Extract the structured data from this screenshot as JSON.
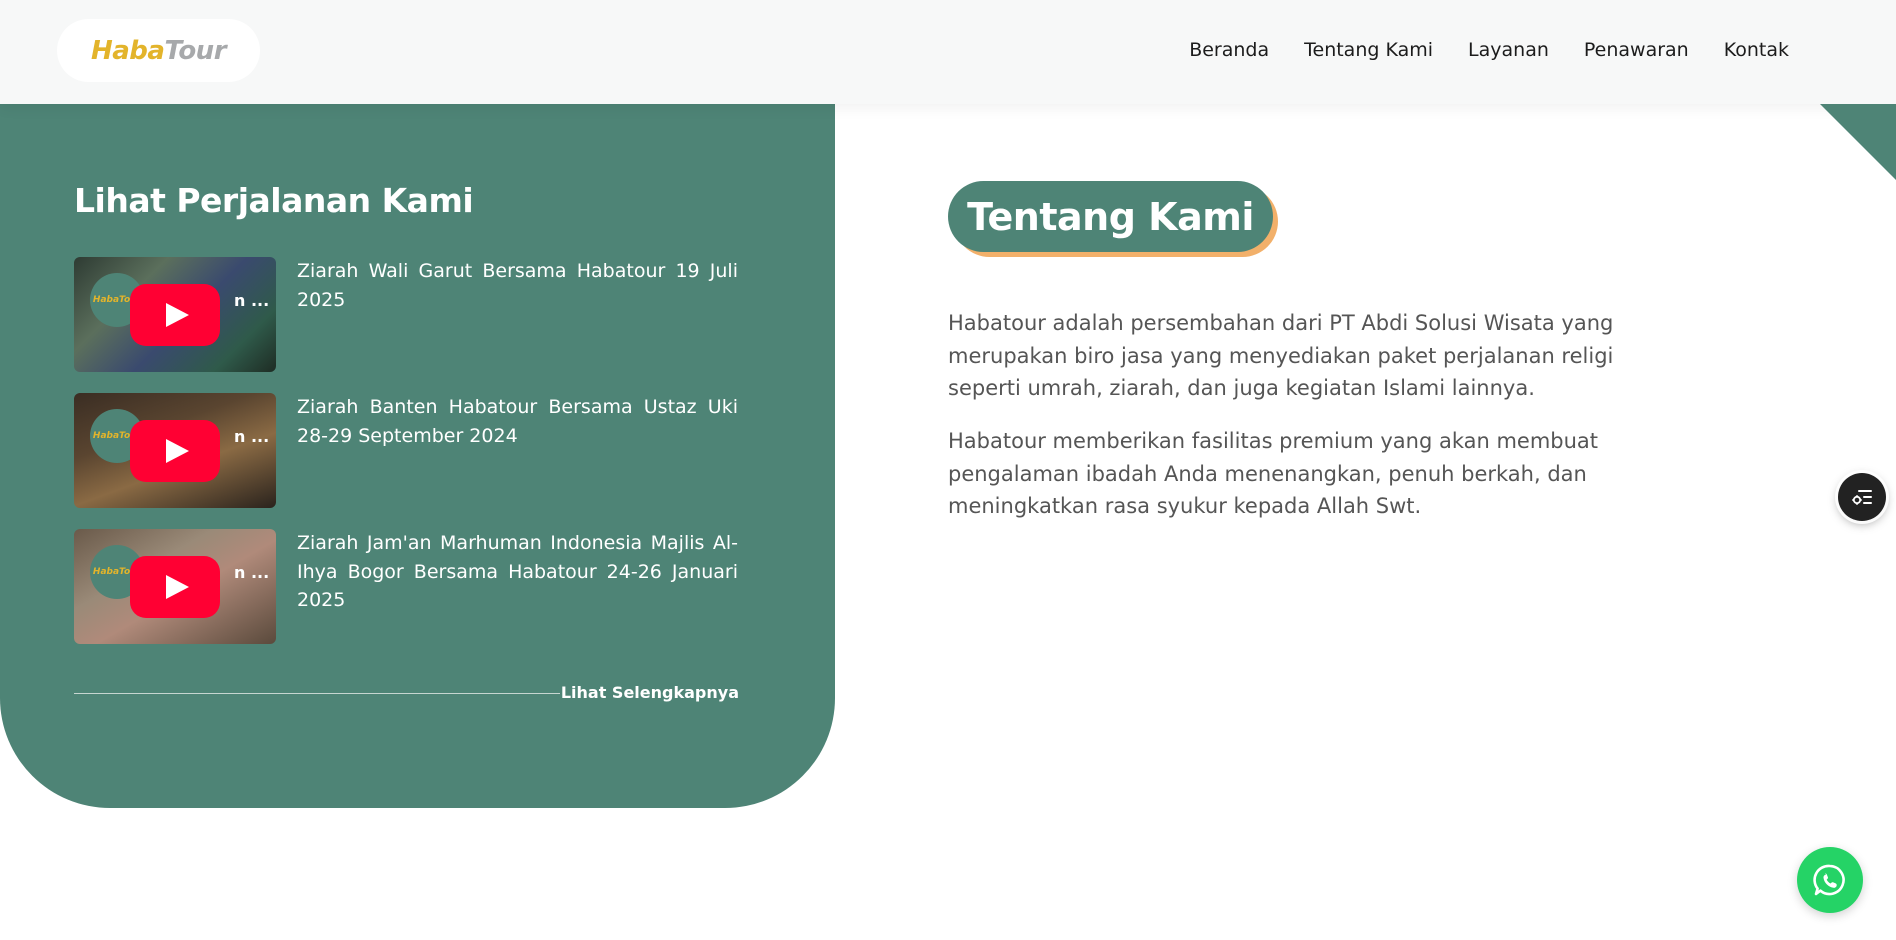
{
  "header": {
    "logo": {
      "part1": "Haba",
      "part2": "Tour"
    },
    "nav": [
      {
        "label": "Beranda"
      },
      {
        "label": "Tentang Kami"
      },
      {
        "label": "Layanan"
      },
      {
        "label": "Penawaran"
      },
      {
        "label": "Kontak"
      }
    ]
  },
  "videos_section": {
    "title": "Lihat Perjalanan Kami",
    "thumb_logo": "HabaTour",
    "thumb_overlay": "n ...",
    "items": [
      {
        "title": "Ziarah Wali Garut Bersama Habatour 19 Juli 2025"
      },
      {
        "title": "Ziarah Banten Habatour Bersama Ustaz Uki 28-29 September 2024"
      },
      {
        "title": "Ziarah Jam'an Marhuman Indonesia Majlis Al-Ihya Bogor Bersama Habatour 24-26 Januari 2025"
      }
    ],
    "see_more": "Lihat Selengkapnya"
  },
  "about": {
    "title": "Tentang Kami",
    "paragraphs": [
      "Habatour adalah persembahan dari PT Abdi Solusi Wisata yang merupakan biro jasa yang menyediakan paket perjalanan religi seperti umrah, ziarah, dan juga kegiatan Islami lainnya.",
      "Habatour memberikan fasilitas premium yang akan membuat pengalaman ibadah Anda menenangkan, penuh berkah, dan meningkatkan rasa syukur kepada Allah Swt."
    ]
  },
  "icons": {
    "menu": "list-settings-icon",
    "whatsapp": "whatsapp-icon",
    "play": "play-icon"
  },
  "colors": {
    "brand_green": "#4e8476",
    "accent_orange": "#f2b06a",
    "logo_gold": "#e3b42b",
    "whatsapp_green": "#25d366",
    "youtube_red": "#ff0033"
  }
}
